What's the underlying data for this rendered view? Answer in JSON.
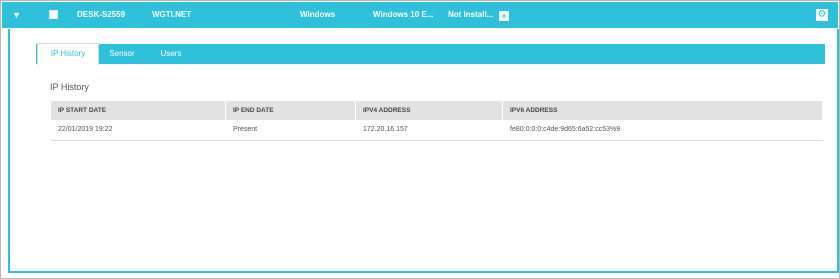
{
  "row": {
    "expand_icon": "▼",
    "device_name": "DESK-S2559",
    "domain": "WGTI.NET",
    "os": "Windows",
    "os_version": "Windows 10 E...",
    "status": "Not Install...",
    "plus_label": "+",
    "settings_icon": "⚙"
  },
  "tabs": [
    {
      "label": "IP History",
      "active": true
    },
    {
      "label": "Sensor",
      "active": false
    },
    {
      "label": "Users",
      "active": false
    }
  ],
  "ip_history": {
    "title": "IP History",
    "columns": [
      "IP START DATE",
      "IP END DATE",
      "IPV4 ADDRESS",
      "IPV6 ADDRESS"
    ],
    "rows": [
      [
        "22/01/2019 19:22",
        "Present",
        "172.20.16.157",
        "fe80:0:0:0:c4de:9d65:6a52:cc53%9"
      ]
    ]
  },
  "colors": {
    "accent": "#2fc0db",
    "header_bg": "#e2e2e2"
  }
}
